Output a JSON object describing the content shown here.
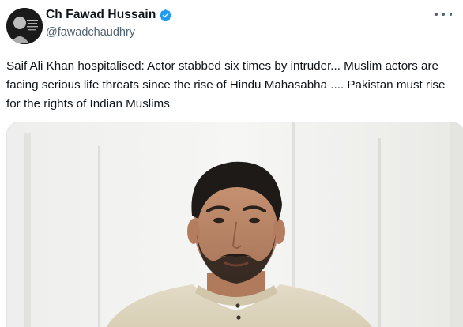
{
  "author": {
    "display_name": "Ch Fawad Hussain",
    "handle": "@fawadchaudhry",
    "verified": true,
    "avatar_icon": "profile-photo"
  },
  "post": {
    "text": "Saif Ali Khan hospitalised: Actor stabbed six times by intruder... Muslim actors are facing serious life threats since the rise of Hindu Mahasabha .... Pakistan must rise for the rights of Indian Muslims"
  },
  "media": {
    "type": "photo",
    "subject": "man-portrait"
  },
  "colors": {
    "verified_blue": "#1d9bf0",
    "text_primary": "#0f1419",
    "text_secondary": "#536471"
  }
}
